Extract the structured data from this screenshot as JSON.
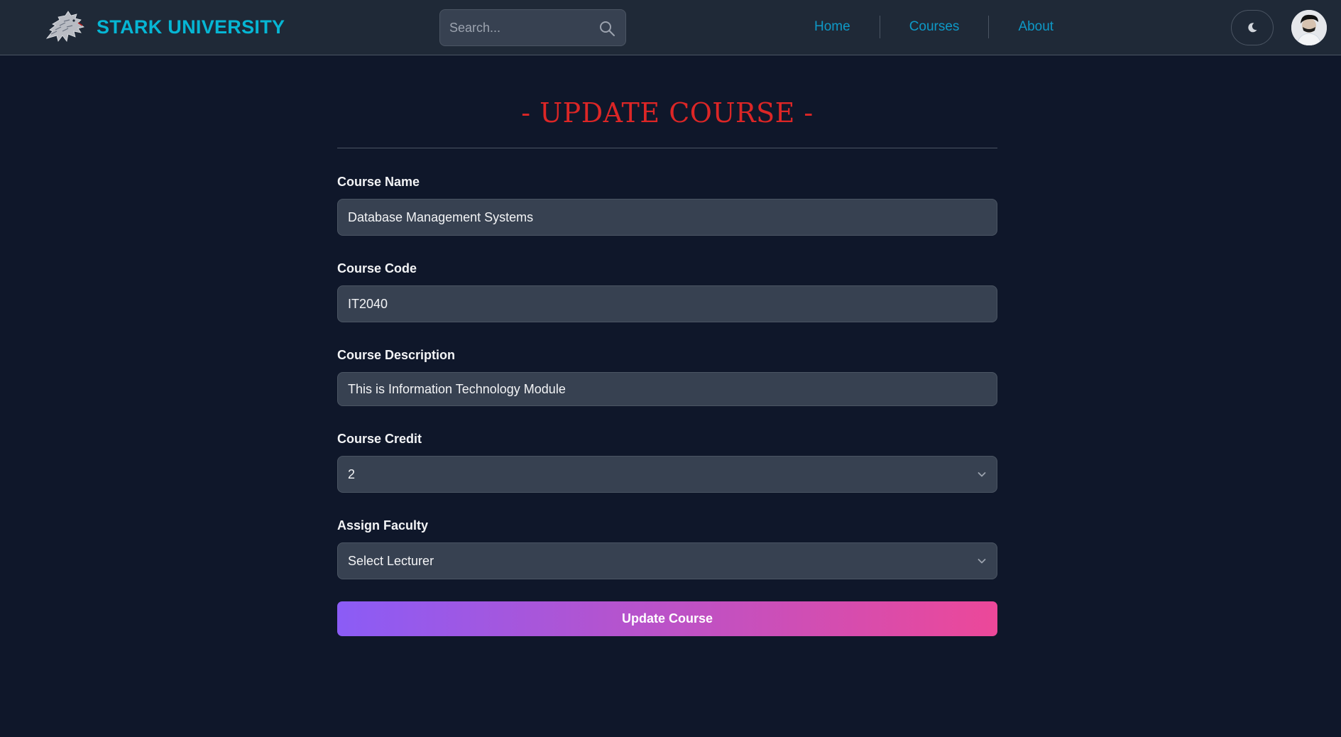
{
  "brand": {
    "name": "STARK UNIVERSITY",
    "logo_icon": "direwolf-logo-icon"
  },
  "search": {
    "placeholder": "Search...",
    "icon": "search-icon"
  },
  "nav": {
    "links": [
      "Home",
      "Courses",
      "About"
    ]
  },
  "header": {
    "theme_icon": "moon-icon",
    "avatar_icon": "user-avatar"
  },
  "form": {
    "title": "- UPDATE COURSE -",
    "course_name": {
      "label": "Course Name",
      "value": "Database Management Systems"
    },
    "course_code": {
      "label": "Course Code",
      "value": "IT2040"
    },
    "course_description": {
      "label": "Course Description",
      "value": "This is Information Technology Module"
    },
    "course_credit": {
      "label": "Course Credit",
      "selected": "2"
    },
    "assign_faculty": {
      "label": "Assign Faculty",
      "selected": "Select Lecturer"
    },
    "submit_label": "Update Course"
  },
  "colors": {
    "page_bg": "#0f172a",
    "navbar_bg": "#1f2937",
    "field_bg": "#374151",
    "brand": "#06b6d4",
    "nav_link": "#0e99c7",
    "title": "#dc2626",
    "button_gradient_start": "#8b5cf6",
    "button_gradient_end": "#ec4899"
  }
}
